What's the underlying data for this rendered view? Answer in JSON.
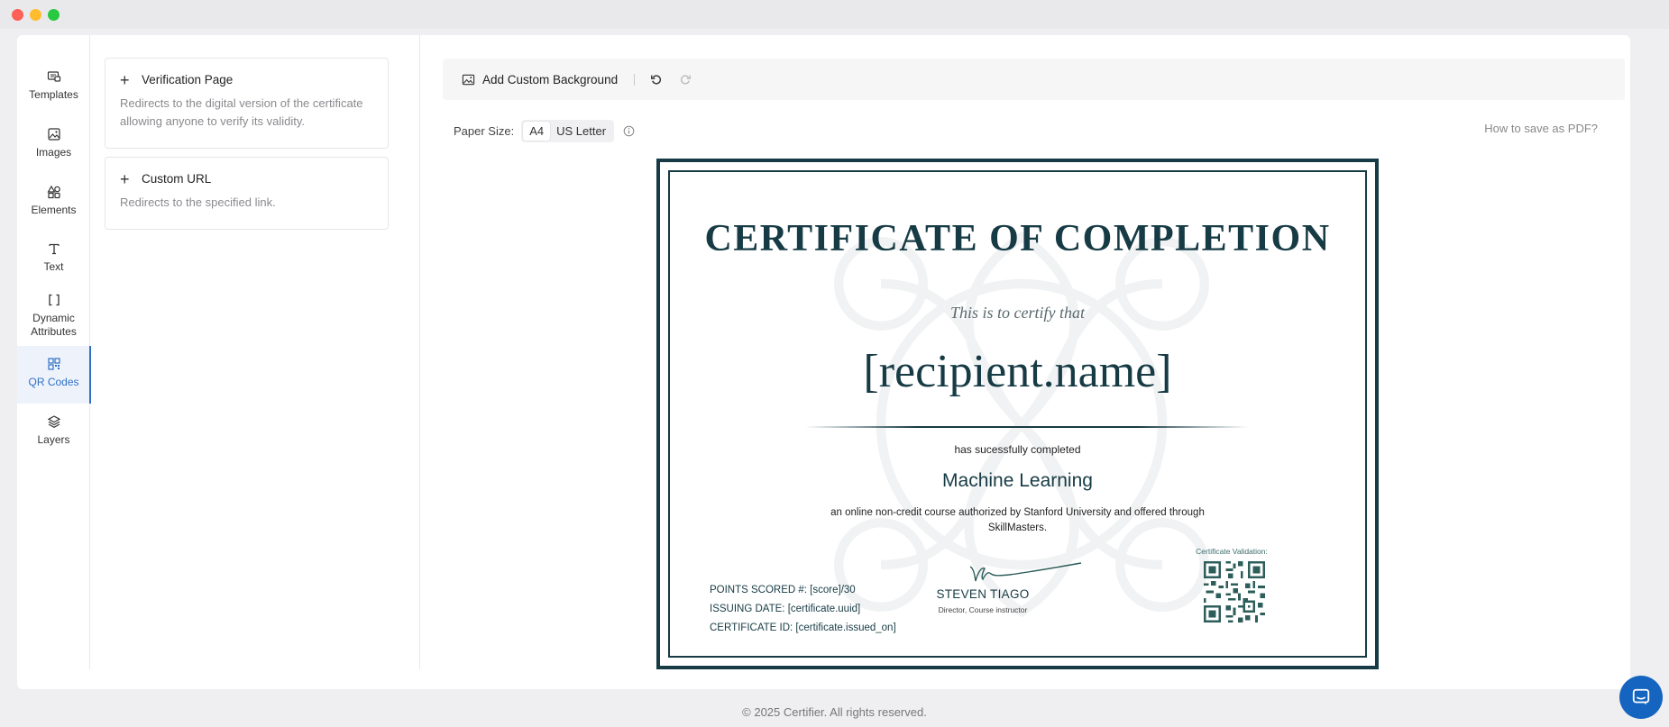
{
  "window": {
    "title": ""
  },
  "sidebar": {
    "items": [
      {
        "label": "Templates",
        "icon": "templates-icon"
      },
      {
        "label": "Images",
        "icon": "image-icon"
      },
      {
        "label": "Elements",
        "icon": "elements-icon"
      },
      {
        "label": "Text",
        "icon": "text-icon"
      },
      {
        "label": "Dynamic Attributes",
        "icon": "brackets-icon"
      },
      {
        "label": "QR Codes",
        "icon": "qr-code-icon",
        "active": true
      },
      {
        "label": "Layers",
        "icon": "layers-icon"
      }
    ]
  },
  "panel": {
    "options": [
      {
        "title": "Verification Page",
        "description": "Redirects to the digital version of the certificate allowing anyone to verify its validity."
      },
      {
        "title": "Custom URL",
        "description": "Redirects to the specified link."
      }
    ]
  },
  "toolbar": {
    "add_background": "Add Custom Background",
    "undo": "undo-icon",
    "redo": "redo-icon"
  },
  "paper": {
    "label": "Paper Size:",
    "options": [
      "A4",
      "US Letter"
    ],
    "selected": "A4",
    "help_link": "How to save as PDF?"
  },
  "certificate": {
    "title": "CERTIFICATE OF COMPLETION",
    "subtitle": "This is to certify that",
    "recipient": "[recipient.name]",
    "completed_text": "has sucessfully completed",
    "course": "Machine Learning",
    "description": "an online non-credit course authorized by Stanford University and offered through SkillMasters.",
    "fields": [
      "POINTS SCORED #: [score]/30",
      "ISSUING DATE: [certificate.uuid]",
      "CERTIFICATE ID: [certificate.issued_on]"
    ],
    "signer_name": "STEVEN TIAGO",
    "signer_role": "Director, Course instructor",
    "qr_label": "Certificate Validation:",
    "border_color": "#173b45"
  },
  "footer": {
    "text": "© 2025 Certifier. All rights reserved."
  },
  "colors": {
    "accent": "#2f6fc4",
    "chat": "#1565c0"
  }
}
